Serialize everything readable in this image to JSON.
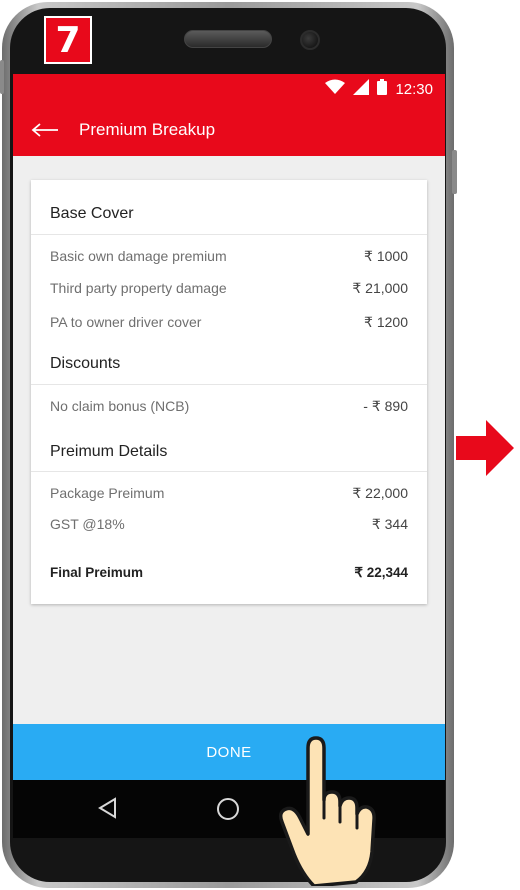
{
  "step_badge": "7",
  "status_bar": {
    "time": "12:30",
    "icons": [
      "wifi-icon",
      "signal-icon",
      "battery-icon"
    ]
  },
  "app_bar": {
    "title": "Premium Breakup",
    "back_icon": "back-arrow-icon"
  },
  "sections": [
    {
      "title": "Base Cover",
      "rows": [
        {
          "label": "Basic own damage premium",
          "value": "₹ 1000"
        },
        {
          "label": "Third party property damage",
          "value": "₹ 21,000"
        },
        {
          "label": "PA to owner driver cover",
          "value": "₹ 1200"
        }
      ]
    },
    {
      "title": "Discounts",
      "rows": [
        {
          "label": "No claim bonus (NCB)",
          "value": "- ₹ 890"
        }
      ]
    },
    {
      "title": "Preimum Details",
      "rows": [
        {
          "label": "Package Preimum",
          "value": "₹ 22,000"
        },
        {
          "label": "GST @18%",
          "value": "₹ 344"
        }
      ]
    }
  ],
  "final": {
    "label": "Final Preimum",
    "value": "₹ 22,344"
  },
  "done_label": "DONE",
  "colors": {
    "brand_red": "#e8091b",
    "done_blue": "#29abf3"
  }
}
